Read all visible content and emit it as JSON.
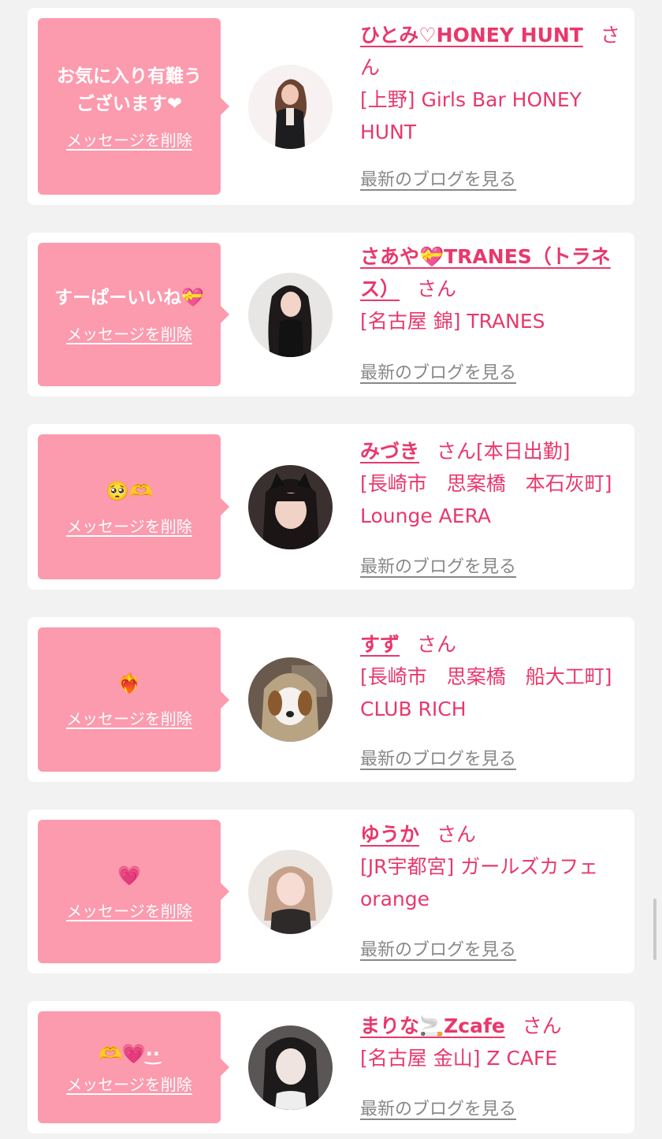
{
  "delete_label": "メッセージを削除",
  "blog_label": "最新のブログを見る",
  "san_label": "さん",
  "cards": [
    {
      "message": "お気に入り有難う\nございます❤",
      "name": "ひとみ♡HONEY HUNT",
      "work": "",
      "shop": "[上野] Girls Bar HONEY HUNT"
    },
    {
      "message": "すーぱーいいね💝",
      "name": "さあや💝TRANES（トラネス）",
      "work": "",
      "shop": "[名古屋 錦] TRANES"
    },
    {
      "message": "🥺🫶",
      "name": "みづき",
      "work": "[本日出勤]",
      "shop": "[長崎市　思案橋　本石灰町] Lounge AERA"
    },
    {
      "message": "❤️‍🔥",
      "name": "すず",
      "work": "",
      "shop": "[長崎市　思案橋　船大工町] CLUB RICH"
    },
    {
      "message": "💗",
      "name": "ゆうか",
      "work": "",
      "shop": "[JR宇都宮] ガールズカフェ orange"
    },
    {
      "message": "🫶💗·͜·",
      "name": "まりな🚬Zcafe",
      "work": "",
      "shop": "[名古屋 金山] Z CAFE"
    }
  ],
  "colors": {
    "accent": "#e8386c",
    "bubble": "#fc9aae",
    "background": "#f2f2f2",
    "link_gray": "#888888"
  }
}
